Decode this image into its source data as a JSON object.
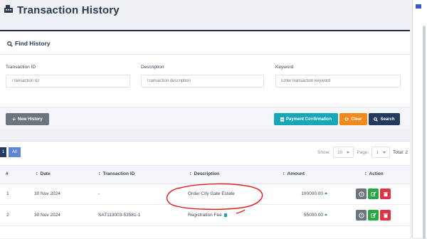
{
  "header": {
    "title": "Transaction History",
    "title_icon": "register-icon"
  },
  "find": {
    "title": "Find History",
    "fields": {
      "transaction_id": {
        "label": "Transaction ID",
        "placeholder": "Transaction ID"
      },
      "description": {
        "label": "Description",
        "placeholder": "Transaction description"
      },
      "keyword": {
        "label": "Keyword",
        "placeholder": "Enter transaction keyword"
      }
    }
  },
  "toolbar": {
    "new_label": "New History",
    "payment_label": "Payment Confirmation",
    "clear_label": "Clear",
    "search_label": "Search"
  },
  "pagination": {
    "page_chip": "1",
    "all_chip": "All",
    "show_label": "Show:",
    "show_value": "10",
    "page_label": "Page:",
    "page_value": "1",
    "total_label": "Total: 2"
  },
  "table": {
    "headers": [
      "#",
      "Date",
      "Transaction ID",
      "Description",
      "Amount",
      "Action"
    ],
    "rows": [
      {
        "num": "1",
        "date": "30 Nov 2024",
        "txid": "-",
        "desc": "Order City Gate Estate",
        "amount": "100000.00"
      },
      {
        "num": "2",
        "date": "30 Nov 2024",
        "txid": "SAT113003-53581-1",
        "desc": "Registration Fee",
        "amount": "55000.00"
      }
    ]
  },
  "colors": {
    "navy": "#223a5e",
    "teal": "#16a8b8",
    "orange": "#f08a1a",
    "green": "#28a745",
    "red": "#dc3545",
    "annotation": "#e01b1b"
  }
}
